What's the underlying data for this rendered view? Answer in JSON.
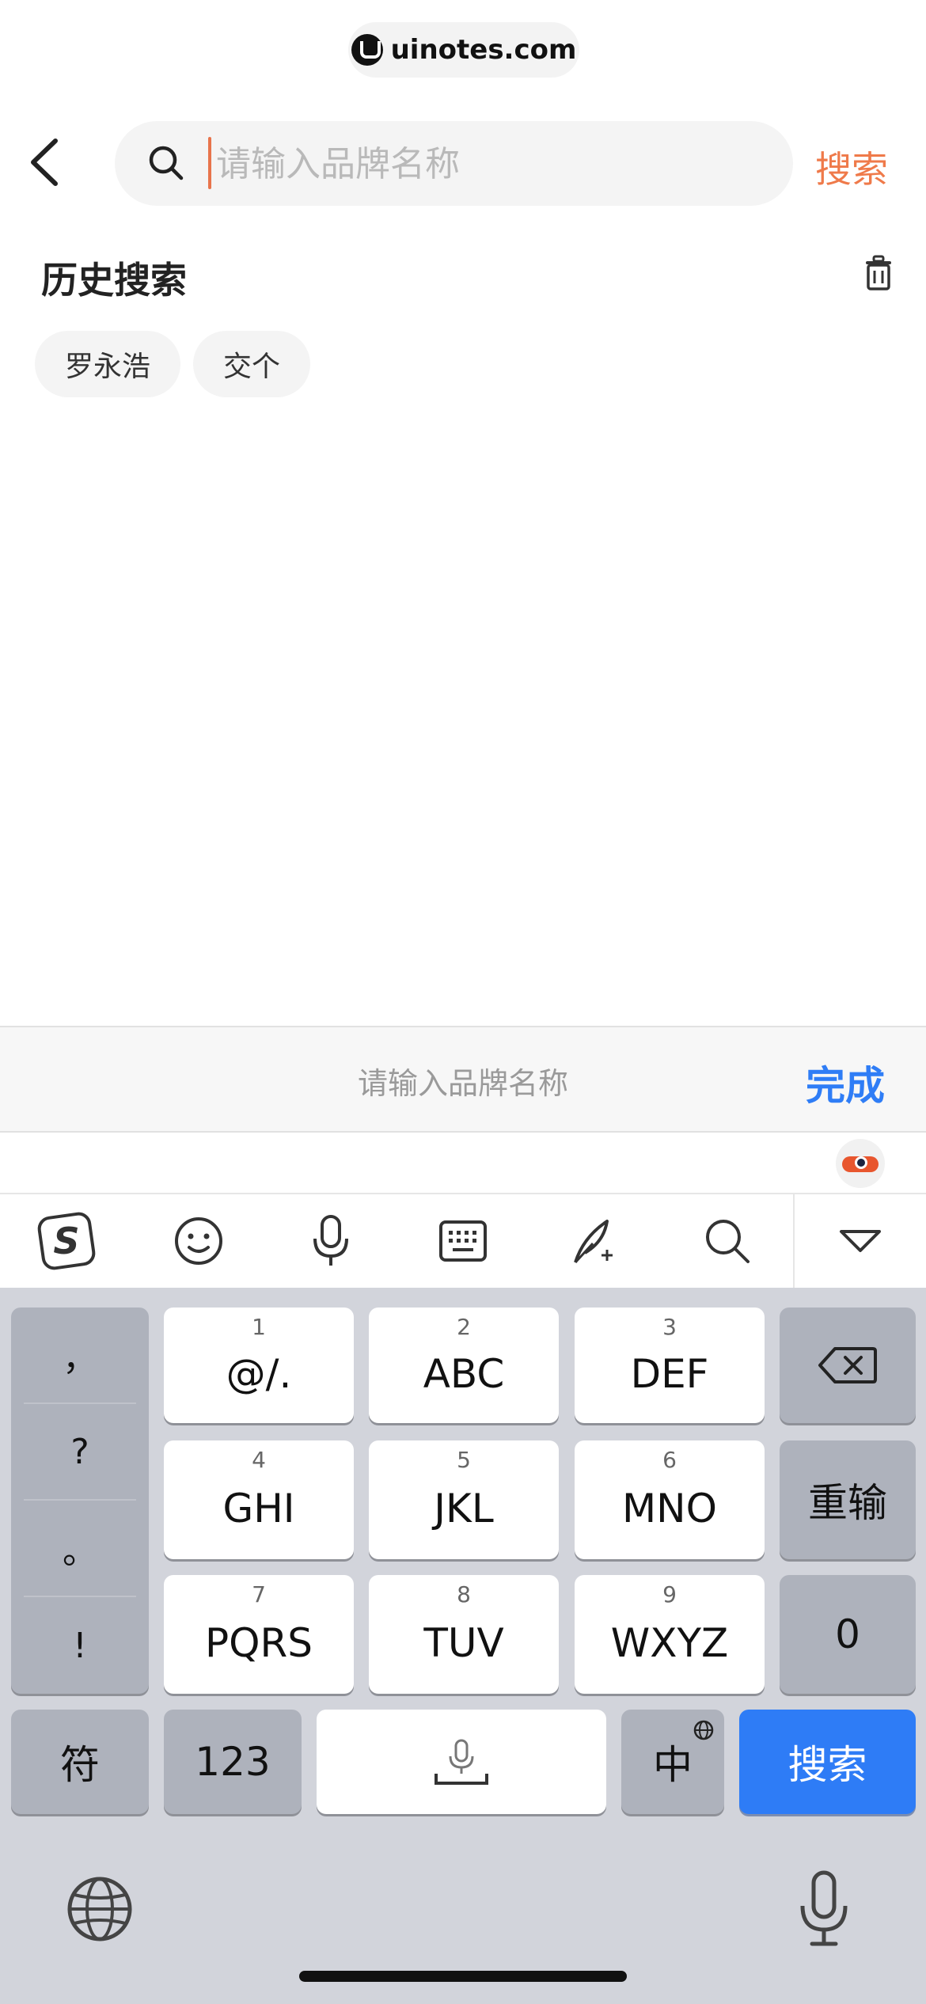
{
  "watermark": {
    "text": "uinotes.com"
  },
  "header": {
    "search_placeholder": "请输入品牌名称",
    "search_value": "",
    "search_button": "搜索"
  },
  "history": {
    "title": "历史搜索",
    "chips": [
      "罗永浩",
      "交个"
    ]
  },
  "accessory": {
    "placeholder": "请输入品牌名称",
    "done": "完成"
  },
  "toolbar": {
    "icons": [
      "sogou-logo-icon",
      "emoji-icon",
      "microphone-icon",
      "keyboard-icon",
      "quill-icon",
      "search-icon",
      "collapse-icon"
    ]
  },
  "keyboard": {
    "punct": [
      "，",
      "?",
      "。",
      "!"
    ],
    "keys": [
      {
        "num": "1",
        "label": "@/."
      },
      {
        "num": "2",
        "label": "ABC"
      },
      {
        "num": "3",
        "label": "DEF"
      },
      {
        "num": "4",
        "label": "GHI"
      },
      {
        "num": "5",
        "label": "JKL"
      },
      {
        "num": "6",
        "label": "MNO"
      },
      {
        "num": "7",
        "label": "PQRS"
      },
      {
        "num": "8",
        "label": "TUV"
      },
      {
        "num": "9",
        "label": "WXYZ"
      }
    ],
    "reset": "重输",
    "zero": "0",
    "symbols": "符",
    "numbers": "123",
    "chinese": "中",
    "search": "搜索"
  },
  "colors": {
    "accent_orange": "#ef7a4a",
    "accent_blue": "#2e7cf6",
    "keyboard_bg": "#d2d4db"
  }
}
